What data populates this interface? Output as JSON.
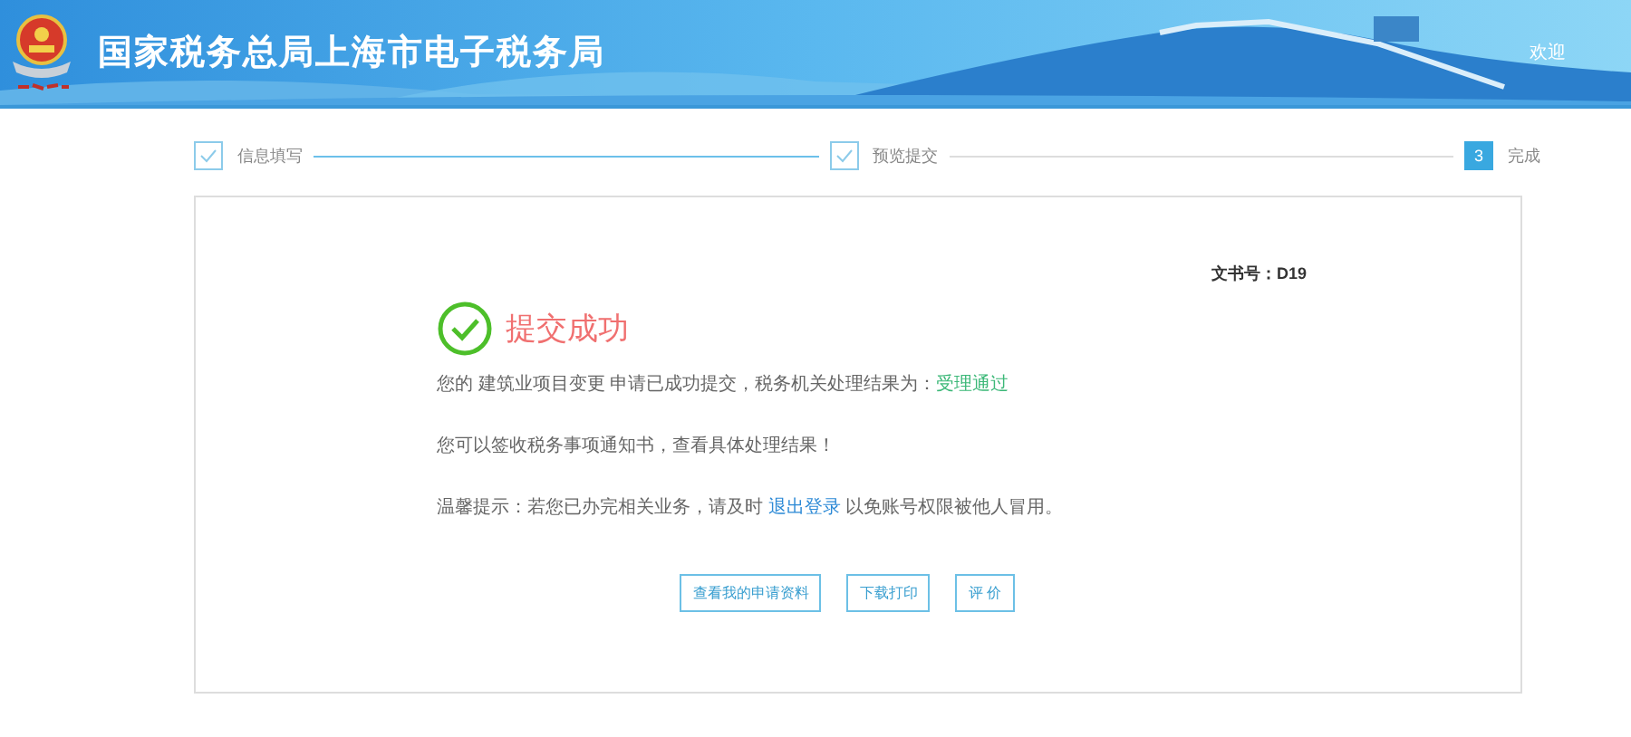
{
  "header": {
    "title": "国家税务总局上海市电子税务局",
    "welcome": "欢迎"
  },
  "steps": [
    {
      "kind": "done",
      "label": "信息填写"
    },
    {
      "kind": "done",
      "label": "预览提交"
    },
    {
      "kind": "current",
      "marker": "3",
      "label": "完成"
    }
  ],
  "result": {
    "doc_number_label": "文书号：",
    "doc_number": "D19",
    "title": "提交成功",
    "message": {
      "text": "您的 建筑业项目变更 申请已成功提交，税务机关处理结果为：",
      "status": "受理通过"
    },
    "notice": "您可以签收税务事项通知书，查看具体处理结果！",
    "tip": {
      "before": "温馨提示：若您已办完相关业务，请及时 ",
      "link": "退出登录",
      "after": " 以免账号权限被他人冒用。"
    },
    "buttons": [
      "查看我的申请资料",
      "下载打印",
      "评 价"
    ]
  }
}
